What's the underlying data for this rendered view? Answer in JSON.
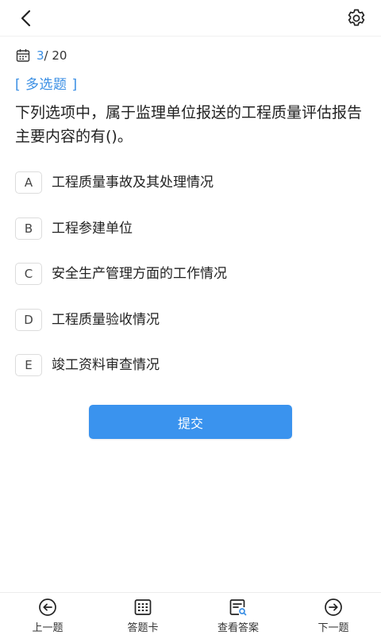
{
  "header": {
    "back_icon": "chevron-left-icon",
    "settings_icon": "gear-icon"
  },
  "progress": {
    "current": "3",
    "total": "/ 20",
    "icon": "calendar-icon"
  },
  "question": {
    "type_label": "[ 多选题 ]",
    "text": "下列选项中，属于监理单位报送的工程质量评估报告主要内容的有()。",
    "options": [
      {
        "letter": "A",
        "text": "工程质量事故及其处理情况"
      },
      {
        "letter": "B",
        "text": "工程参建单位"
      },
      {
        "letter": "C",
        "text": "安全生产管理方面的工作情况"
      },
      {
        "letter": "D",
        "text": "工程质量验收情况"
      },
      {
        "letter": "E",
        "text": "竣工资料审查情况"
      }
    ]
  },
  "submit_label": "提交",
  "bottom_nav": {
    "prev": "上一题",
    "card": "答题卡",
    "answer": "查看答案",
    "next": "下一题"
  },
  "colors": {
    "accent": "#3b8fe4",
    "button": "#3a93ee"
  }
}
